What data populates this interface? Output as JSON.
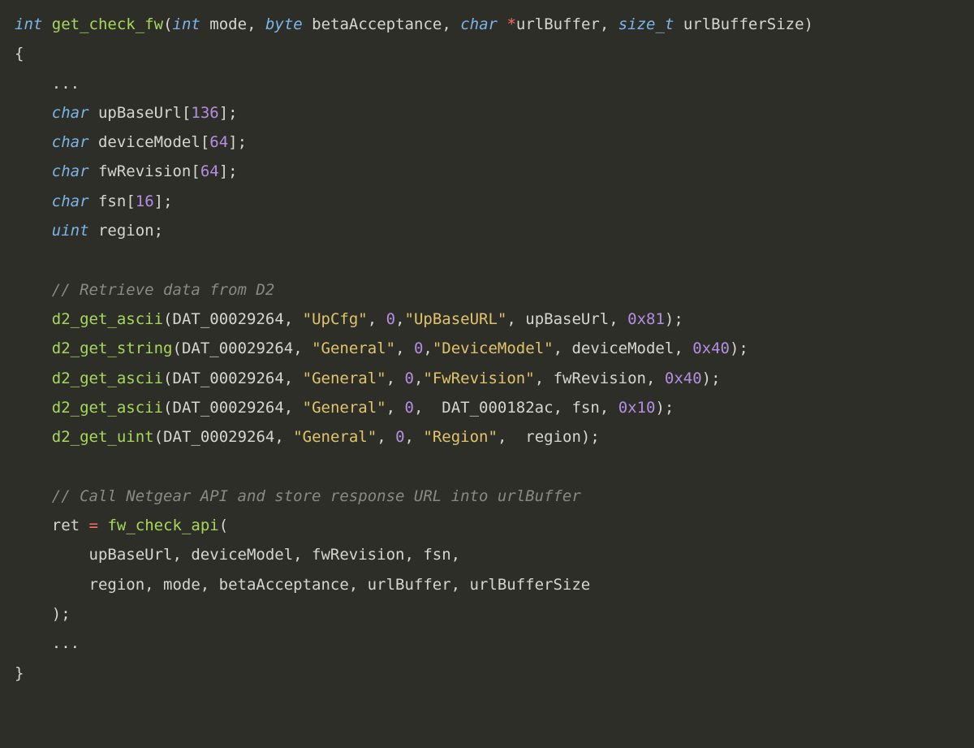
{
  "code": {
    "sig": {
      "ret_type": "int",
      "name": "get_check_fw",
      "p1_type": "int",
      "p1_name": "mode",
      "p2_type": "byte",
      "p2_name": "betaAcceptance",
      "p3_type": "char",
      "p3_name": "urlBuffer",
      "p4_type": "size_t",
      "p4_name": "urlBufferSize"
    },
    "open_brace": "{",
    "ellipsis1": "...",
    "decl": {
      "t_char": "char",
      "t_uint": "uint",
      "upBaseUrl": "upBaseUrl",
      "upBaseUrl_sz": "136",
      "deviceModel": "deviceModel",
      "deviceModel_sz": "64",
      "fwRevision": "fwRevision",
      "fwRevision_sz": "64",
      "fsn": "fsn",
      "fsn_sz": "16",
      "region": "region"
    },
    "comment1": "// Retrieve data from D2",
    "d2": {
      "dat": "DAT_00029264",
      "dat2": "DAT_000182ac",
      "f_ascii": "d2_get_ascii",
      "f_string": "d2_get_string",
      "f_uint": "d2_get_uint",
      "s_upcfg": "\"UpCfg\"",
      "s_general": "\"General\"",
      "s_upbaseurl": "\"UpBaseURL\"",
      "s_devicemodel": "\"DeviceModel\"",
      "s_fwrevision": "\"FwRevision\"",
      "s_region": "\"Region\"",
      "n0": "0",
      "x81": "0x81",
      "x40": "0x40",
      "x10": "0x10"
    },
    "comment2": "// Call Netgear API and store response URL into urlBuffer",
    "call": {
      "ret": "ret",
      "eq": "=",
      "fw_check_api": "fw_check_api",
      "line1": "upBaseUrl, deviceModel, fwRevision, fsn,",
      "line2": "region, mode, betaAcceptance, urlBuffer, urlBufferSize"
    },
    "ellipsis2": "...",
    "close_brace": "}"
  }
}
